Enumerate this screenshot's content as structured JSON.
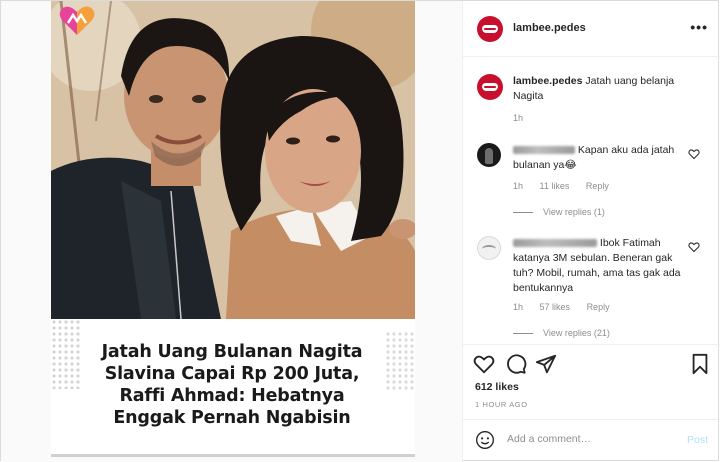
{
  "post": {
    "headline": "Jatah Uang Bulanan Nagita Slavina Capai Rp 200 Juta, Raffi Ahmad: Hebatnya Enggak Pernah Ngabisin"
  },
  "header": {
    "username": "lambee.pedes",
    "more_label": "•••"
  },
  "caption": {
    "username": "lambee.pedes",
    "text": "Jatah uang belanja Nagita",
    "time": "1h"
  },
  "comments": [
    {
      "text": "Kapan aku ada jatah bulanan ya😂",
      "time": "1h",
      "likes": "11 likes",
      "reply_label": "Reply",
      "view_replies": "View replies (1)"
    },
    {
      "text": "Ibok Fatimah katanya 3M sebulan. Beneran gak tuh? Mobil, rumah, ama tas gak ada bentukannya",
      "time": "1h",
      "likes": "57 likes",
      "reply_label": "Reply",
      "view_replies": "View replies (21)"
    }
  ],
  "stats": {
    "likes": "612 likes",
    "time_ago": "1 HOUR AGO"
  },
  "add_comment": {
    "placeholder": "Add a comment…",
    "post_label": "Post"
  },
  "icons": {
    "logo": "heart-logo-icon",
    "like": "heart-icon",
    "comment": "comment-icon",
    "share": "share-icon",
    "save": "bookmark-icon",
    "emoji": "smile-icon"
  },
  "colors": {
    "brand_red": "#c8102e",
    "muted_text": "#8e8e8e",
    "post_button": "#b2dffc"
  }
}
